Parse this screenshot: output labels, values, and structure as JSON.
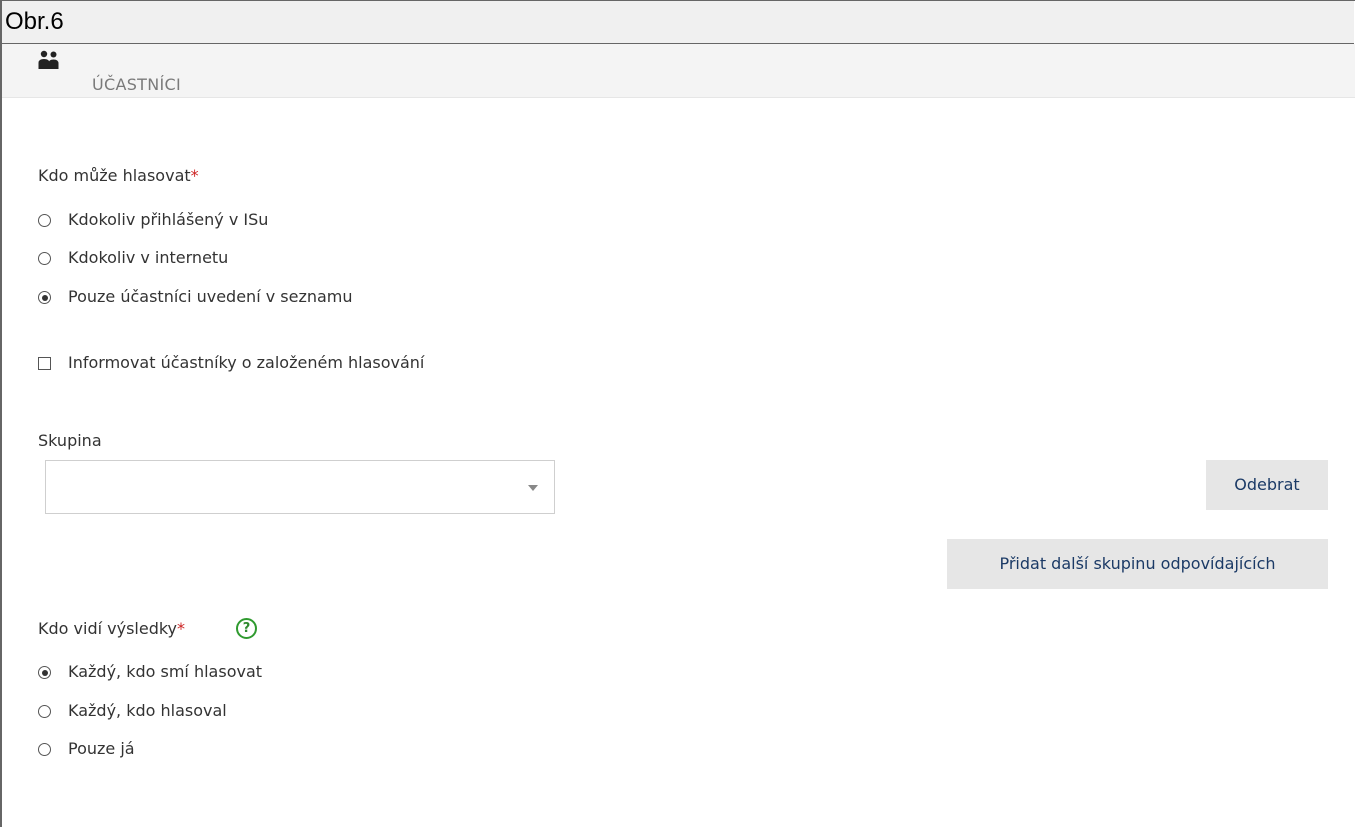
{
  "caption": "Obr.6",
  "section": {
    "icon": "users-icon",
    "title": "ÚČASTNÍCI"
  },
  "who_can_vote": {
    "label": "Kdo může hlasovat",
    "required_mark": "*",
    "options": [
      {
        "label": "Kdokoliv přihlášený v ISu",
        "selected": false
      },
      {
        "label": "Kdokoliv v internetu",
        "selected": false
      },
      {
        "label": "Pouze účastníci uvedení v seznamu",
        "selected": true
      }
    ]
  },
  "notify": {
    "label": "Informovat účastníky o založeném hlasování",
    "checked": false
  },
  "group": {
    "label": "Skupina",
    "value": "",
    "remove_label": "Odebrat",
    "add_label": "Přidat další skupinu odpovídajících"
  },
  "who_sees_results": {
    "label": "Kdo vidí výsledky",
    "required_mark": "*",
    "help_label": "?",
    "options": [
      {
        "label": "Každý, kdo smí hlasovat",
        "selected": true
      },
      {
        "label": "Každý, kdo hlasoval",
        "selected": false
      },
      {
        "label": "Pouze já",
        "selected": false
      }
    ]
  },
  "colors": {
    "button_bg": "#e6e6e6",
    "button_text": "#1b3a66",
    "required": "#cc2222",
    "help": "#2f9a2f"
  }
}
